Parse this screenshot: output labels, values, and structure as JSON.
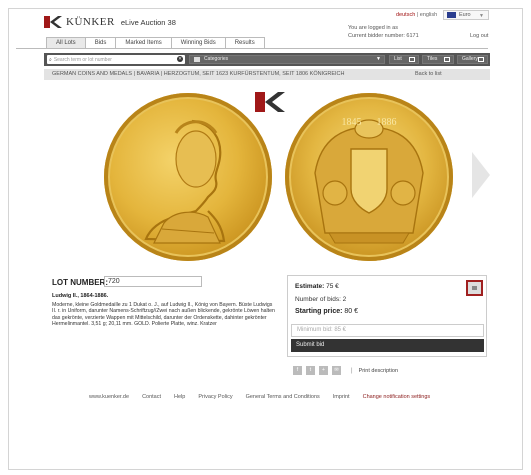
{
  "header": {
    "brand": "KÜNKER",
    "subtitle": "eLive Auction 38",
    "lang_de": "deutsch",
    "lang_sep": "|",
    "lang_en": "english",
    "currency": "Euro",
    "logged_in": "You are logged in as",
    "bidder": "Current bidder number: 6171",
    "logout": "Log out"
  },
  "tabs": [
    "All Lots",
    "Bids",
    "Marked Items",
    "Winning Bids",
    "Results"
  ],
  "toolbar": {
    "search_placeholder": "Search term or lot number",
    "categories": "Categories",
    "view_list": "List",
    "view_tiles": "Tiles",
    "view_gallery": "Gallery"
  },
  "breadcrumb": {
    "text": "GERMAN COINS AND MEDALS  |  BAVARIA  |  HERZOGTUM, SEIT 1623 KURFÜRSTENTUM, SEIT 1806 KÖNIGREICH",
    "back": "Back to list"
  },
  "coin": {
    "reverse_years": "1845      1886"
  },
  "lot": {
    "label": "LOT NUMBER:",
    "number": "720",
    "title": "Ludwig II., 1864-1886.",
    "description": "Moderne, kleine Goldmedaille zu 1 Dukat o. J., auf Ludwig II., König von Bayern. Büste Ludwigs II. r. in Uniform, darunter Namens-Schriftzug//Zwei nach außen blickende, gekrönte Löwen halten das gekrönte, verzierte Wappen mit Mittelschild, darunter der Ordenskette, dahinter gekrönter Hermelinmantel. 3,51 g; 20,11 mm. GOLD. Polierte Platte, winz. Kratzer"
  },
  "bid": {
    "estimate_label": "Estimate:",
    "estimate_value": "75 €",
    "bids_count": "Number of bids: 2",
    "starting_label": "Starting price:",
    "starting_value": "80 €",
    "min_bid_placeholder": "Minimum bid: 85 €",
    "submit": "Submit bid"
  },
  "share": {
    "print": "Print description"
  },
  "footer": [
    "www.kuenker.de",
    "Contact",
    "Help",
    "Privacy Policy",
    "General Terms and Conditions",
    "Imprint",
    "Change notification settings"
  ],
  "colors": {
    "accent": "#a01010",
    "toolbar": "#555555",
    "gold": "#e4b53c"
  }
}
